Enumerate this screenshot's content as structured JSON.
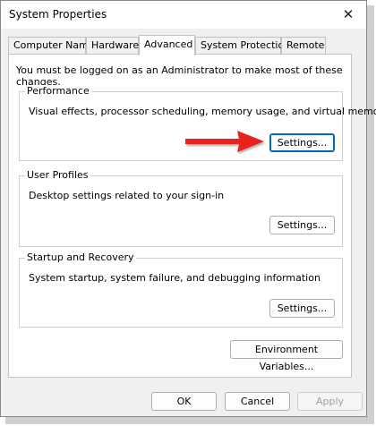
{
  "window": {
    "title": "System Properties",
    "close_glyph": "✕"
  },
  "tabs": [
    {
      "label": "Computer Name",
      "active": false
    },
    {
      "label": "Hardware",
      "active": false
    },
    {
      "label": "Advanced",
      "active": true
    },
    {
      "label": "System Protection",
      "active": false
    },
    {
      "label": "Remote",
      "active": false
    }
  ],
  "admin_note": "You must be logged on as an Administrator to make most of these changes.",
  "groups": {
    "performance": {
      "label": "Performance",
      "description": "Visual effects, processor scheduling, memory usage, and virtual memory",
      "button": "Settings..."
    },
    "user_profiles": {
      "label": "User Profiles",
      "description": "Desktop settings related to your sign-in",
      "button": "Settings..."
    },
    "startup_recovery": {
      "label": "Startup and Recovery",
      "description": "System startup, system failure, and debugging information",
      "button": "Settings..."
    }
  },
  "environment_button": "Environment Variables...",
  "footer": {
    "ok": "OK",
    "cancel": "Cancel",
    "apply": "Apply"
  },
  "annotation": {
    "icon": "red-arrow-icon",
    "color": "#e8201c"
  }
}
